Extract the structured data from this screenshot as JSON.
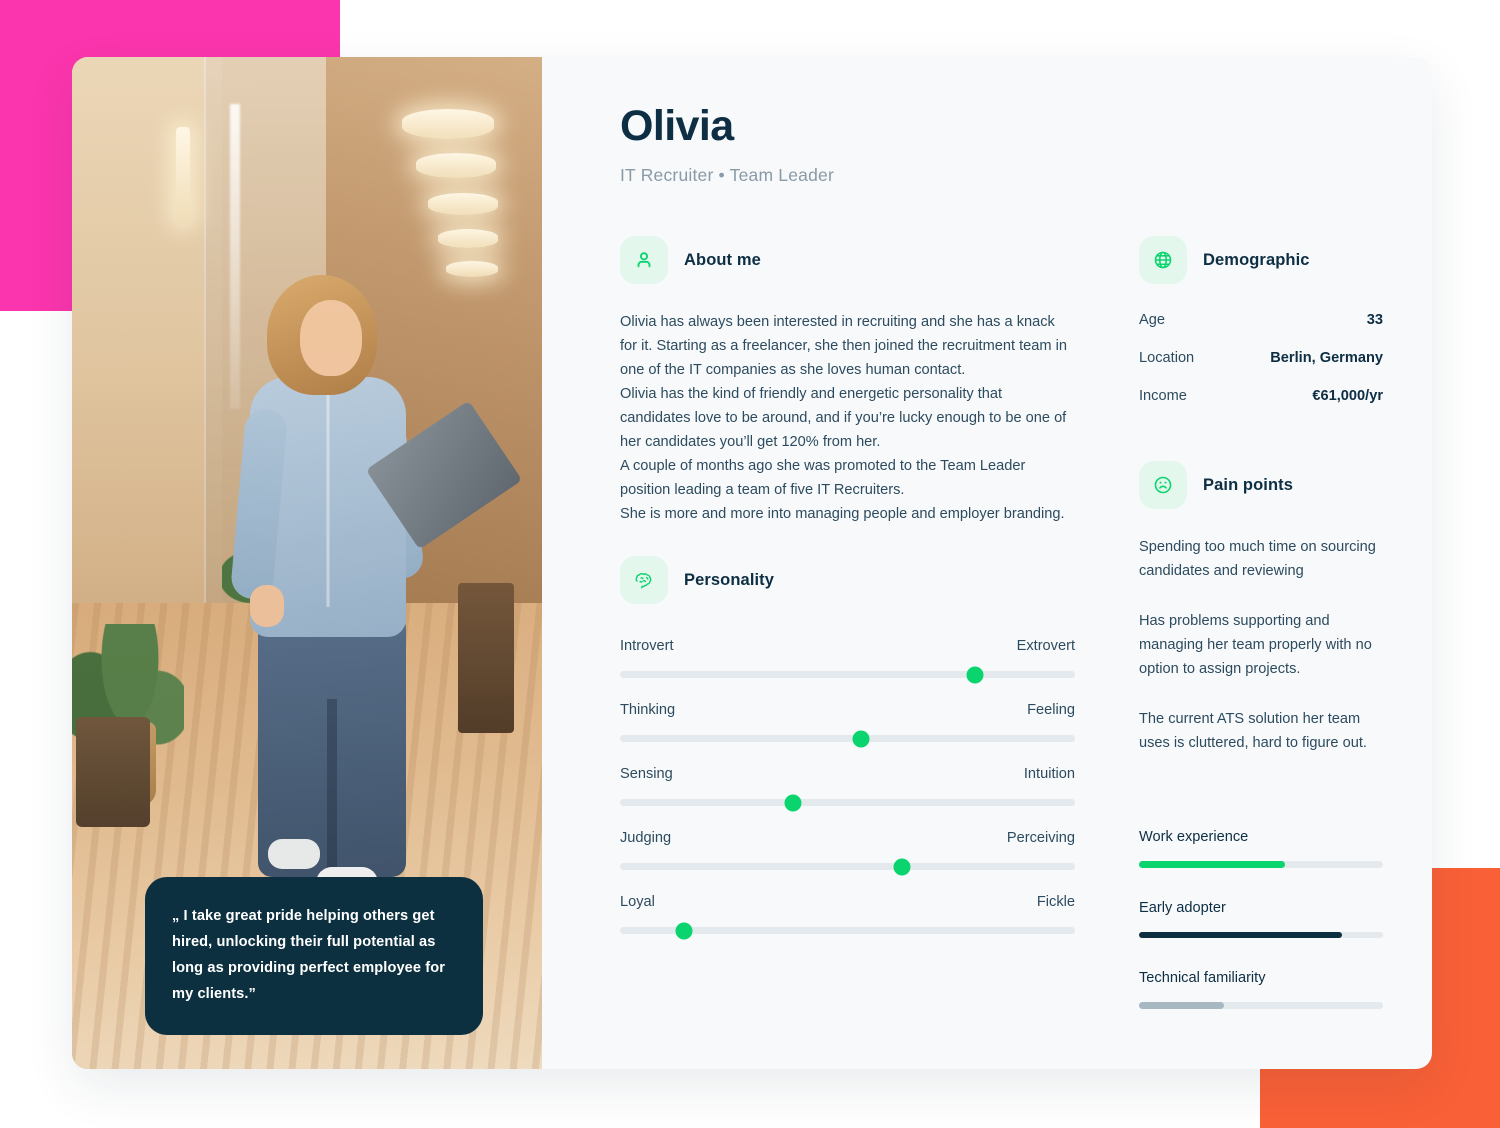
{
  "decor": {
    "pink": "#fb35ad",
    "orange": "#f96037"
  },
  "theme": {
    "accent_green": "#0ad46e",
    "dark_navy": "#0c3040",
    "card_bg": "#f7f9fb",
    "icon_bg": "#e4f7ed",
    "track": "#e4e9ed"
  },
  "profile": {
    "name": "Olivia",
    "role": "IT Recruiter  •  Team Leader"
  },
  "quote": {
    "text": "„ I take great pride helping others get hired, unlocking their full potential as long as providing perfect employee for my clients.”"
  },
  "about": {
    "icon": "person-icon",
    "title": "About me",
    "paragraphs": [
      "Olivia has always been interested in recruiting and she has a knack for it. Starting as a freelancer, she then joined the recruitment team in one of the IT companies as she loves human contact.",
      "Olivia has the kind of friendly and energetic personality that candidates love to be around, and if you’re lucky enough to be one of her candidates you’ll get 120% from her.",
      "A couple of months ago she was promoted to the Team Leader position leading a team of five IT Recruiters.",
      "She is more and more into managing people and employer branding."
    ]
  },
  "demographic": {
    "icon": "globe-icon",
    "title": "Demographic",
    "rows": [
      {
        "label": "Age",
        "value": "33"
      },
      {
        "label": "Location",
        "value": "Berlin,  Germany"
      },
      {
        "label": "Income",
        "value": "€61,000/yr"
      }
    ]
  },
  "pain_points": {
    "icon": "sad-face-icon",
    "title": "Pain points",
    "items": [
      "Spending too much time on sourcing candidates and reviewing",
      "Has problems supporting and managing her team properly with no option to assign projects.",
      "The current ATS solution her team uses is cluttered, hard to figure out."
    ]
  },
  "personality": {
    "icon": "brain-icon",
    "title": "Personality",
    "sliders": [
      {
        "left": "Introvert",
        "right": "Extrovert",
        "value": 78
      },
      {
        "left": "Thinking",
        "right": "Feeling",
        "value": 53
      },
      {
        "left": "Sensing",
        "right": "Intuition",
        "value": 38
      },
      {
        "left": "Judging",
        "right": "Perceiving",
        "value": 62
      },
      {
        "left": "Loyal",
        "right": "Fickle",
        "value": 14
      }
    ]
  },
  "skills": [
    {
      "label": "Work experience",
      "value": 60,
      "color": "#0ad46e"
    },
    {
      "label": "Early adopter",
      "value": 83,
      "color": "#0c3040"
    },
    {
      "label": "Technical familiarity",
      "value": 35,
      "color": "#a7b8c2"
    }
  ]
}
